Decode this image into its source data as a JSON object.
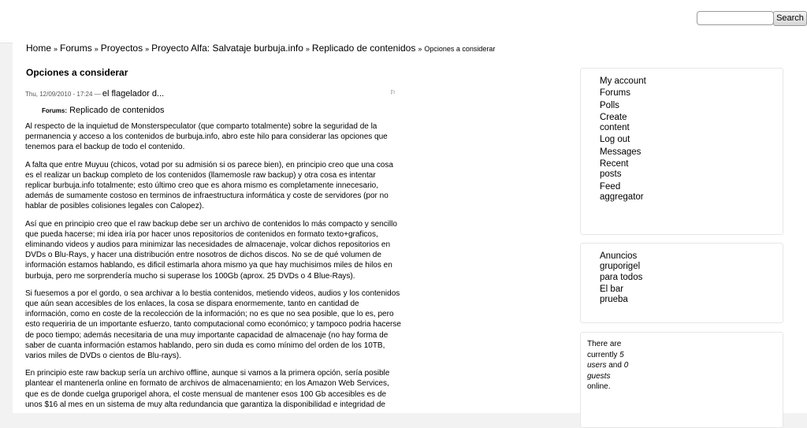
{
  "search": {
    "button_label": "Search",
    "value": ""
  },
  "breadcrumb": {
    "items": [
      "Home",
      "Forums",
      "Proyectos",
      "Proyecto Alfa: Salvataje burbuja.info",
      "Replicado de contenidos"
    ],
    "separator": "»",
    "current": "Opciones a considerar"
  },
  "node": {
    "title": "Opciones a considerar",
    "date": "Thu, 12/09/2010 - 17:24 —",
    "author": "el flagelador d...",
    "forums_label": "Forums:",
    "forum_link": "Replicado de contenidos",
    "paragraphs": [
      "Al respecto de la inquietud de Monsterspeculator (que comparto totalmente) sobre la seguridad de la permanencia y acceso a los contenidos de burbuja.info, abro este hilo para considerar las opciones que tenemos para el backup de todo el contenido.",
      "A falta que entre Muyuu (chicos, votad por su admisión si os parece bien), en principio creo que una cosa es el realizar un backup completo de los contenidos (llamemosle raw backup) y otra cosa es intentar replicar burbuja.info totalmente; esto último creo que es ahora mismo es completamente innecesario, además de sumamente costoso en terminos de infraestructura informática y coste de servidores (por no hablar de posibles colisiones legales con Calopez).",
      "Así que en principio creo que el raw backup debe ser un archivo de contenidos lo más compacto y sencillo que pueda hacerse; mi idea iría por hacer unos repositorios de contenidos en formato texto+graficos, eliminando videos y audios para minimizar las necesidades de almacenaje, volcar dichos repositorios en DVDs o Blu-Rays, y hacer una distribución entre nosotros de dichos discos. No se de qué volumen de información estamos hablando, es dificil estimarla ahora mismo ya que hay muchisimos miles de hilos en burbuja, pero me sorprendería mucho si superase los 100Gb (aprox. 25 DVDs o 4 Blue-Rays).",
      "Si fuesemos a por el gordo, o sea archivar a lo bestia contenidos, metiendo videos, audios y los contenidos que aún sean accesibles de los enlaces, la cosa se dispara enormemente, tanto en cantidad de información, como en coste de la recolección de la información; no es que no sea posible, que lo es, pero esto requeriria de un importante esfuerzo, tanto computacional como económico; y tampoco podria hacerse de poco tiempo; además necesitaria de una muy importante capacidad de almacenaje (no hay forma de saber de cuanta información estamos hablando, pero sin duda es como mínimo del orden de los 10TB, varios miles de DVDs o cientos de Blu-rays).",
      "En principio este raw backup sería un archivo offline, aunque si vamos a la primera opción, sería posible plantear el mantenerla online en formato de archivos de almacenamiento; en los Amazon Web Services, que es de donde cuelga gruporigel ahora, el coste mensual de mantener esos 100 Gb accesibles es de unos $16 al mes en un sistema de muy alta redundancia que garantiza la disponibilidad e integridad de"
    ]
  },
  "sidebar": {
    "nav": [
      "My account",
      "Forums",
      "Polls",
      "Create content",
      "Log out",
      "Messages",
      "Recent posts",
      "Feed aggregator"
    ],
    "links": [
      "Anuncios gruporigel para todos",
      "El bar prueba"
    ],
    "online": {
      "t1": "There are currently",
      "users": "5 users",
      "t2": "and",
      "guests": "0 guests",
      "t3": "online."
    }
  }
}
